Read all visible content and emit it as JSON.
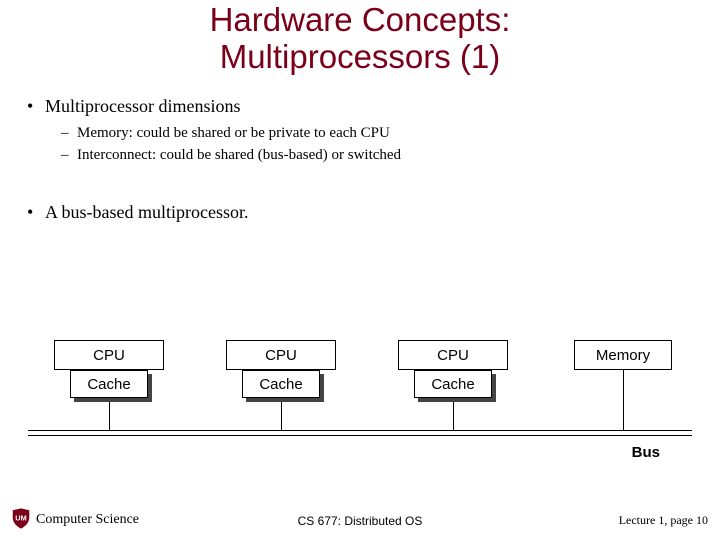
{
  "title_line1": "Hardware Concepts:",
  "title_line2": "Multiprocessors (1)",
  "bullets": {
    "b1": "Multiprocessor dimensions",
    "b1_sub1": "Memory: could be shared or be private to each CPU",
    "b1_sub2": "Interconnect: could be shared (bus-based) or switched",
    "b2": "A bus-based multiprocessor."
  },
  "diagram": {
    "cpu": "CPU",
    "cache": "Cache",
    "memory": "Memory",
    "bus": "Bus"
  },
  "footer": {
    "dept": "Computer Science",
    "center": "CS 677: Distributed OS",
    "right": "Lecture 1, page 10"
  }
}
